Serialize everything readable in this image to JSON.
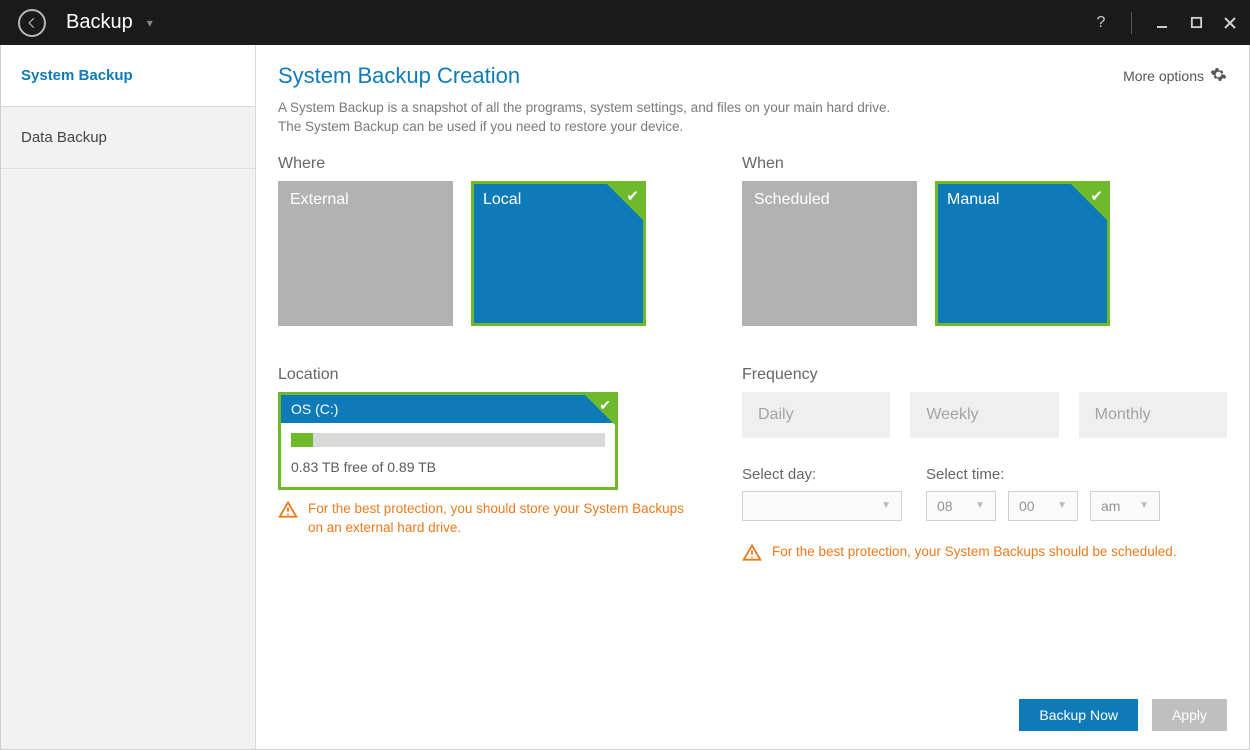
{
  "titlebar": {
    "title": "Backup"
  },
  "sidebar": {
    "items": [
      {
        "label": "System Backup",
        "active": true
      },
      {
        "label": "Data Backup",
        "active": false
      }
    ]
  },
  "header": {
    "page_title": "System Backup Creation",
    "more_options": "More options"
  },
  "description": {
    "line1": "A System Backup is a snapshot of all the programs, system settings, and files on your main hard drive.",
    "line2": "The System Backup can be used if you need to restore your device."
  },
  "where": {
    "label": "Where",
    "options": [
      {
        "label": "External",
        "selected": false
      },
      {
        "label": "Local",
        "selected": true
      }
    ]
  },
  "when": {
    "label": "When",
    "options": [
      {
        "label": "Scheduled",
        "selected": false
      },
      {
        "label": "Manual",
        "selected": true
      }
    ]
  },
  "location": {
    "label": "Location",
    "drive": "OS (C:)",
    "free_text": "0.83 TB free of 0.89 TB",
    "used_percent": 7,
    "warning": "For the best protection, you should store your System Backups on an external hard drive."
  },
  "frequency": {
    "label": "Frequency",
    "options": [
      "Daily",
      "Weekly",
      "Monthly"
    ]
  },
  "select_day": {
    "label": "Select day:",
    "value": ""
  },
  "select_time": {
    "label": "Select time:",
    "hour": "08",
    "minute": "00",
    "ampm": "am"
  },
  "schedule_warning": "For the best protection, your System Backups should be scheduled.",
  "footer": {
    "backup_now": "Backup Now",
    "apply": "Apply"
  }
}
